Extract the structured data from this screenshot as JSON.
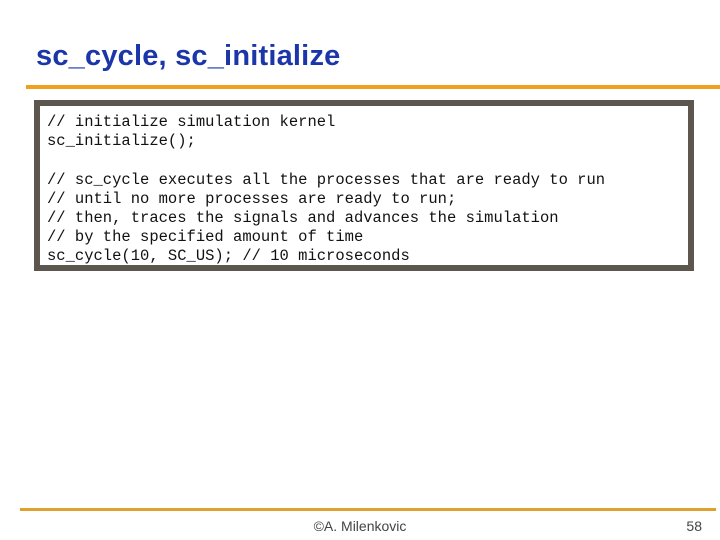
{
  "slide": {
    "title": "sc_cycle, sc_initialize",
    "code_lines": [
      "// initialize simulation kernel",
      "sc_initialize();",
      "",
      "// sc_cycle executes all the processes that are ready to run",
      "// until no more processes are ready to run;",
      "// then, traces the signals and advances the simulation",
      "// by the specified amount of time",
      "sc_cycle(10, SC_US); // 10 microseconds"
    ],
    "footer": "©A. Milenkovic",
    "page_number": "58"
  },
  "colors": {
    "title": "#1b36a8",
    "accent_rule": "#f0a020",
    "code_border": "#5c564e"
  }
}
